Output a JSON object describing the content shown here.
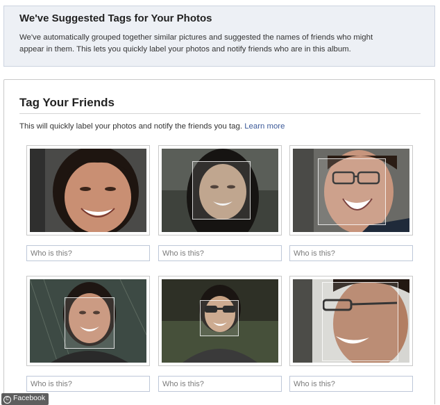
{
  "notice": {
    "title": "We've Suggested Tags for Your Photos",
    "line1": "We've automatically grouped together similar pictures and suggested the names of friends who might",
    "line2": "appear in them. This lets you quickly label your photos and notify friends who are in this album."
  },
  "panel": {
    "title": "Tag Your Friends",
    "intro": "This will quickly label your photos and notify the friends you tag.",
    "learn_more": "Learn more"
  },
  "photos": [
    {
      "placeholder": "Who is this?"
    },
    {
      "placeholder": "Who is this?"
    },
    {
      "placeholder": "Who is this?"
    },
    {
      "placeholder": "Who is this?"
    },
    {
      "placeholder": "Who is this?"
    },
    {
      "placeholder": "Who is this?"
    }
  ],
  "credit": {
    "icon": "copyright-icon",
    "text": "Facebook"
  }
}
